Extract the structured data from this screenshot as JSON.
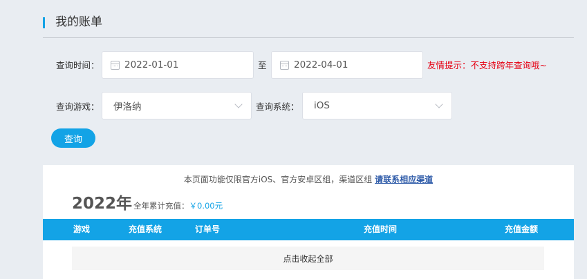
{
  "header": {
    "title": "我的账单"
  },
  "query": {
    "time_label": "查询时间：",
    "start_date": "2022-01-01",
    "to_label": "至",
    "end_date": "2022-04-01",
    "hint": "友情提示：不支持跨年查询哦~",
    "game_label": "查询游戏：",
    "game_value": "伊洛纳",
    "system_label": "查询系统：",
    "system_value": "iOS",
    "button": "查询"
  },
  "panel": {
    "notice_text": "本页面功能仅限官方iOS、官方安卓区组，渠道区组",
    "notice_link": "请联系相应渠道",
    "year": "2022年",
    "total_label": "全年累计充值：",
    "total_amount": "￥0.00元",
    "columns": [
      "游戏",
      "充值系统",
      "订单号",
      "充值时间",
      "充值金额"
    ],
    "collapse_label": "点击收起全部"
  },
  "colors": {
    "accent": "#13a3e6",
    "hint": "#e60012",
    "background": "#e9edf2"
  }
}
